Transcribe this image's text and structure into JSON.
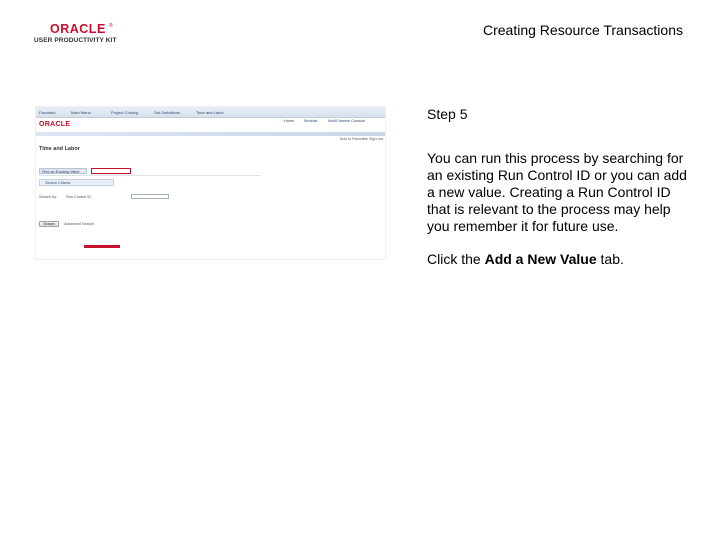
{
  "header": {
    "logo_word": "ORACLE",
    "logo_tm": "®",
    "logo_subtitle": "USER PRODUCTIVITY KIT",
    "title": "Creating Resource Transactions"
  },
  "screenshot": {
    "nav_items": [
      "Favorites",
      "Main Menu",
      "Project Costing",
      "Set Definitions",
      "Time and Labor"
    ],
    "logo": "ORACLE",
    "header_links": [
      "Home",
      "Worklist",
      "MultiChannel Console",
      "Add to Favorites",
      "Sign out"
    ],
    "page_title": "Time and Labor",
    "tab_find": "Find an Existing Value",
    "section_label": "Search Criteria",
    "search_label": "Search by:",
    "search_field_label": "Run Control ID",
    "search_button": "Search",
    "advanced_link": "Advanced Search"
  },
  "content": {
    "step": "Step 5",
    "paragraph": "You can run this process by searching for an existing Run Control ID or you can add a new value. Creating a Run Control ID that is relevant to the process may help you remember it for future use.",
    "instruction_before": "Click the ",
    "instruction_bold": "Add a New Value",
    "instruction_after": " tab."
  },
  "colors": {
    "oracle_red": "#c8102e"
  }
}
